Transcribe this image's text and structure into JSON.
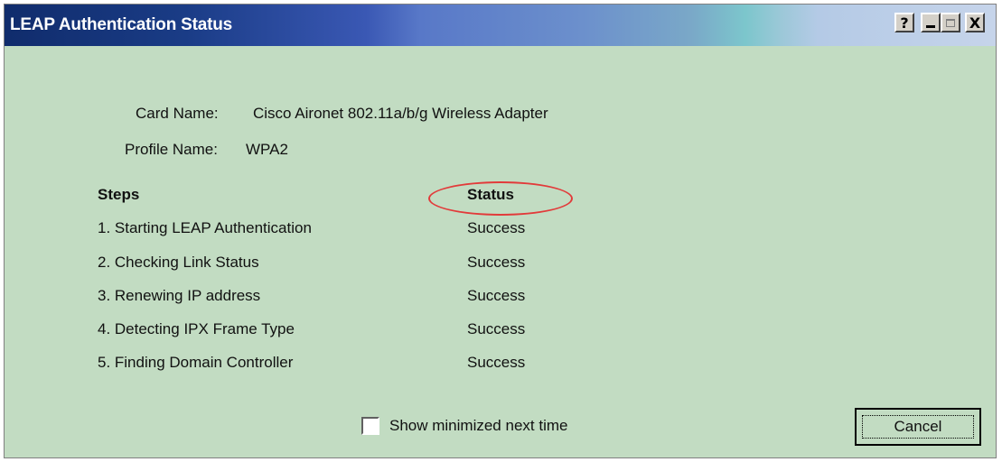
{
  "window": {
    "title": "LEAP Authentication Status",
    "controls": {
      "help": "?",
      "minimize": "_",
      "maximize": "□",
      "close": "X"
    }
  },
  "info": {
    "card_name_label": "Card Name:",
    "card_name_value": "Cisco Aironet 802.11a/b/g Wireless Adapter",
    "profile_name_label": "Profile Name:",
    "profile_name_value": "WPA2"
  },
  "table": {
    "steps_header": "Steps",
    "status_header": "Status",
    "rows": [
      {
        "step": "1. Starting LEAP Authentication",
        "status": "Success"
      },
      {
        "step": "2. Checking Link Status",
        "status": "Success"
      },
      {
        "step": "3. Renewing IP address",
        "status": "Success"
      },
      {
        "step": "4. Detecting IPX Frame Type",
        "status": "Success"
      },
      {
        "step": "5. Finding Domain Controller",
        "status": "Success"
      }
    ]
  },
  "footer": {
    "checkbox_label": "Show minimized next time",
    "checkbox_checked": false,
    "cancel_label": "Cancel"
  },
  "annotation": {
    "highlight_color": "#e23a3a",
    "highlighted": "Status"
  }
}
